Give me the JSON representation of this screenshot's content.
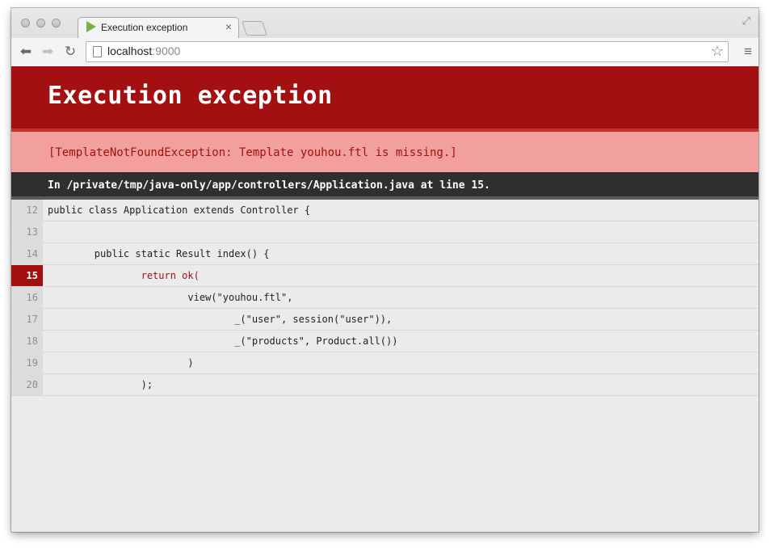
{
  "browser": {
    "tab_title": "Execution exception",
    "tab_close": "×",
    "url_host": "localhost",
    "url_port": ":9000"
  },
  "page": {
    "heading": "Execution exception",
    "message": "[TemplateNotFoundException: Template youhou.ftl is missing.]",
    "source_location": "In /private/tmp/java-only/app/controllers/Application.java at line 15."
  },
  "code": {
    "error_line": 15,
    "lines": [
      {
        "num": "12",
        "text": "public class Application extends Controller {"
      },
      {
        "num": "13",
        "text": ""
      },
      {
        "num": "14",
        "text": "        public static Result index() {"
      },
      {
        "num": "15",
        "text": "                return ok("
      },
      {
        "num": "16",
        "text": "                        view(\"youhou.ftl\","
      },
      {
        "num": "17",
        "text": "                                _(\"user\", session(\"user\")),"
      },
      {
        "num": "18",
        "text": "                                _(\"products\", Product.all())"
      },
      {
        "num": "19",
        "text": "                        )"
      },
      {
        "num": "20",
        "text": "                );"
      }
    ]
  },
  "colors": {
    "header_bg": "#a31012",
    "message_bg": "#f2a09e",
    "source_bar_bg": "#2f2f2f"
  }
}
